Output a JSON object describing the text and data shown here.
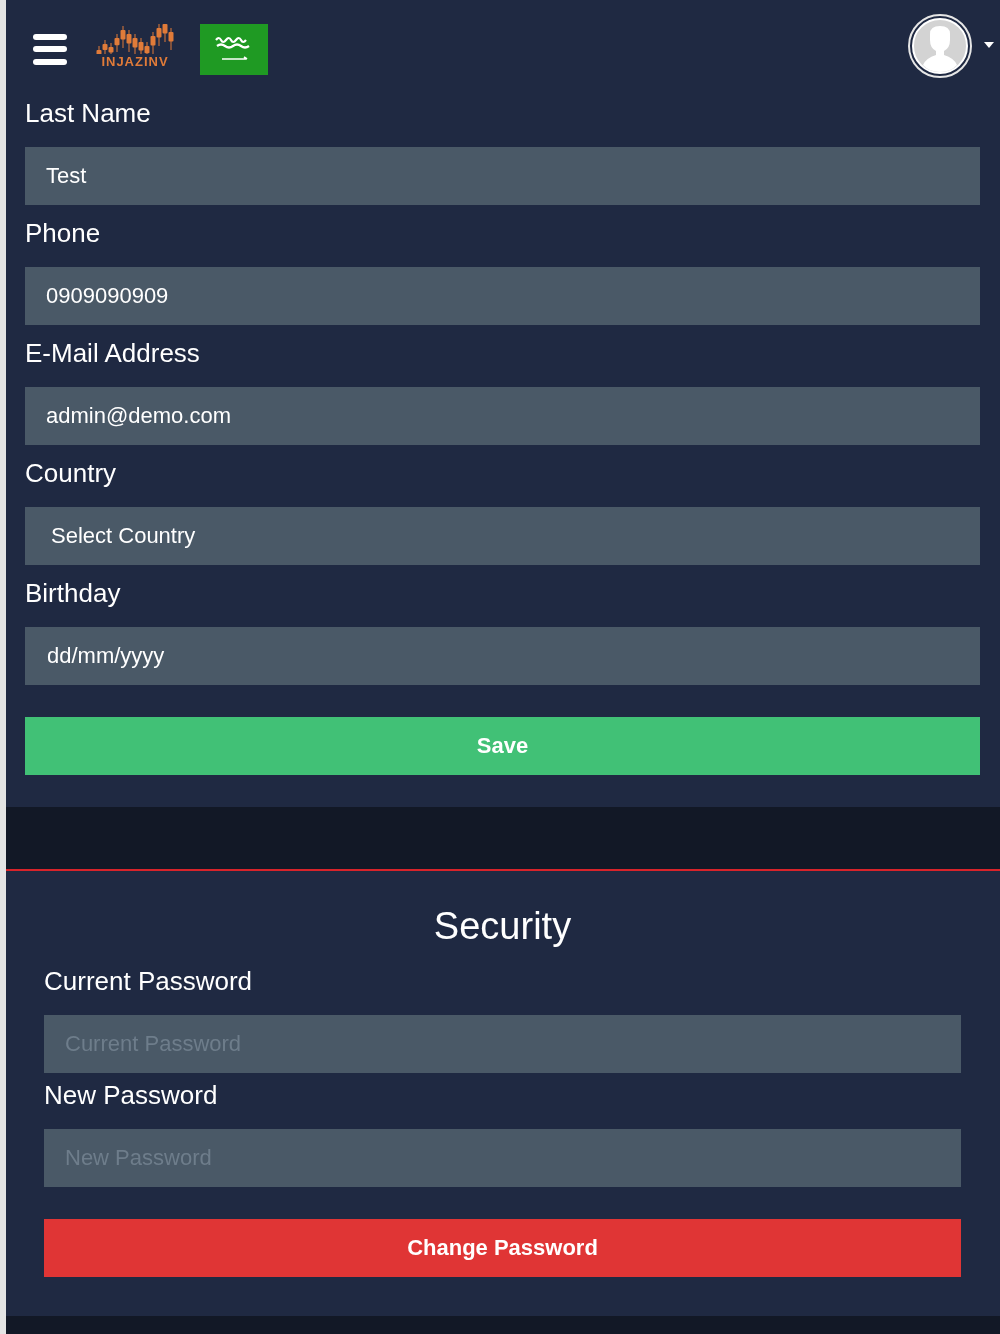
{
  "header": {
    "logo_text": "INJAZINV"
  },
  "profile_form": {
    "fields": [
      {
        "label": "Last Name",
        "value": "Test",
        "kind": "text"
      },
      {
        "label": "Phone",
        "value": "0909090909",
        "kind": "text"
      },
      {
        "label": "E-Mail Address",
        "value": "admin@demo.com",
        "kind": "text"
      },
      {
        "label": "Country",
        "value": "Select Country",
        "kind": "select"
      },
      {
        "label": "Birthday",
        "value": "dd/mm/yyyy",
        "kind": "date"
      }
    ],
    "save_button": "Save"
  },
  "security": {
    "title": "Security",
    "fields": [
      {
        "label": "Current Password",
        "placeholder": "Current Password"
      },
      {
        "label": "New Password",
        "placeholder": "New Password"
      }
    ],
    "button": "Change Password"
  }
}
